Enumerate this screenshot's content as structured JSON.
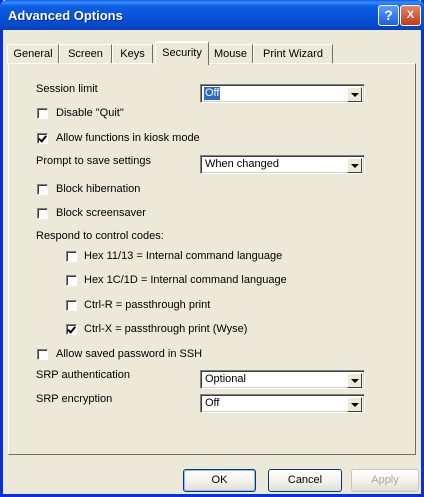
{
  "window": {
    "title": "Advanced Options",
    "help_label": "?",
    "close_label": "X"
  },
  "tabs": [
    {
      "label": "General",
      "active": false
    },
    {
      "label": "Screen",
      "active": false
    },
    {
      "label": "Keys",
      "active": false
    },
    {
      "label": "Security",
      "active": true
    },
    {
      "label": "Mouse",
      "active": false
    },
    {
      "label": "Print Wizard",
      "active": false
    }
  ],
  "security": {
    "session_limit": {
      "label": "Session limit",
      "value": "Off"
    },
    "disable_quit": {
      "label": "Disable \"Quit\"",
      "checked": false
    },
    "allow_kiosk": {
      "label": "Allow functions in kiosk mode",
      "checked": true
    },
    "prompt_save": {
      "label": "Prompt to save settings",
      "value": "When changed"
    },
    "block_hibernation": {
      "label": "Block hibernation",
      "checked": false
    },
    "block_screensaver": {
      "label": "Block screensaver",
      "checked": false
    },
    "respond_label": "Respond to control codes:",
    "codes": [
      {
        "label": "Hex 11/13 = Internal command language",
        "checked": false
      },
      {
        "label": "Hex 1C/1D = Internal command language",
        "checked": false
      },
      {
        "label": "Ctrl-R = passthrough print",
        "checked": false
      },
      {
        "label": "Ctrl-X = passthrough print (Wyse)",
        "checked": true
      }
    ],
    "allow_saved_password": {
      "label": "Allow saved password in SSH",
      "checked": false
    },
    "srp_auth": {
      "label": "SRP authentication",
      "value": "Optional"
    },
    "srp_enc": {
      "label": "SRP encryption",
      "value": "Off"
    }
  },
  "buttons": {
    "ok": "OK",
    "cancel": "Cancel",
    "apply": "Apply"
  }
}
